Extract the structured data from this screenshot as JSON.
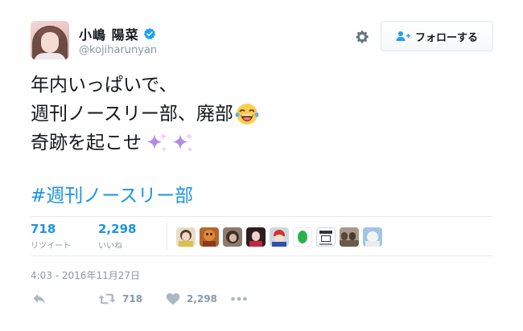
{
  "user": {
    "display_name": "小嶋 陽菜",
    "handle": "@kojiharunyan"
  },
  "follow_button": {
    "label": "フォローする"
  },
  "tweet": {
    "lines": [
      "年内いっぱいで、",
      "週刊ノースリー部、廃部",
      "奇跡を起こせ"
    ],
    "hashtag": "#週刊ノースリー部"
  },
  "stats": {
    "retweets": {
      "count": "718",
      "label": "リツイート"
    },
    "likes": {
      "count": "2,298",
      "label": "いいね"
    }
  },
  "timestamp": "4:03 - 2016年11月27日",
  "actions": {
    "retweet_count": "718",
    "like_count": "2,298"
  },
  "icons": {
    "verified": "verified-badge-icon",
    "settings": "gear-icon",
    "follow": "person-add-icon",
    "reply": "reply-arrow-icon",
    "retweet": "retweet-icon",
    "like": "heart-icon",
    "more": "more-dots-icon",
    "emoji_laugh": "tears-of-joy-emoji",
    "emoji_sparkles": "sparkles-emoji"
  },
  "colors": {
    "link": "#1b95e0",
    "muted": "#8899a6",
    "text": "#14171a",
    "divider": "#e6ecf0",
    "verified": "#1da1f2"
  },
  "liker_avatars": [
    "avatar-1",
    "avatar-2",
    "avatar-3",
    "avatar-4",
    "avatar-5",
    "avatar-6",
    "avatar-7",
    "avatar-8",
    "avatar-9"
  ]
}
